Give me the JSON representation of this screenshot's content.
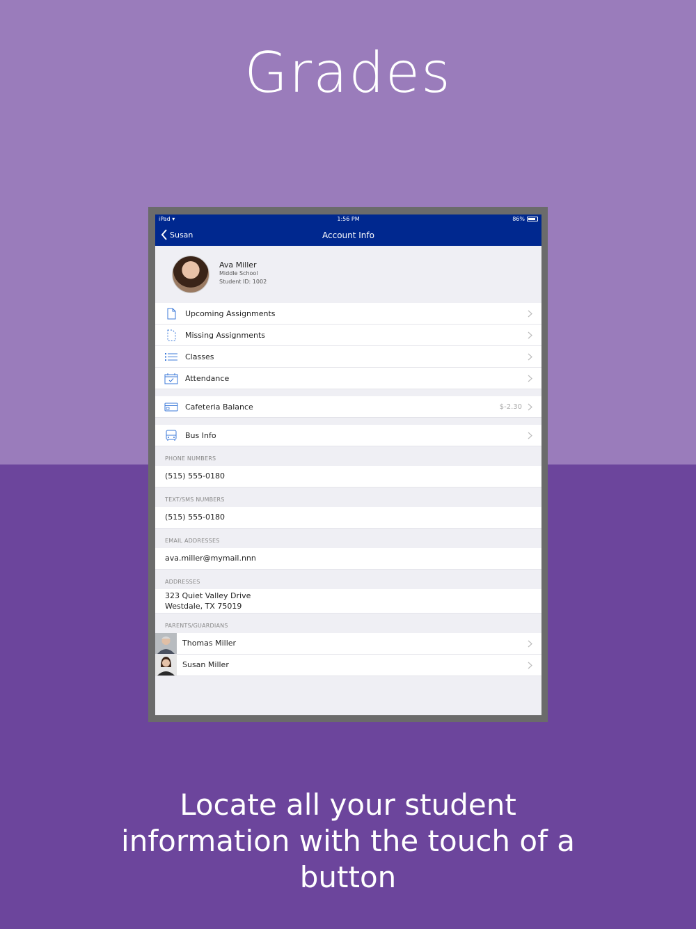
{
  "headline": "Grades",
  "tagline": "Locate all your student information with the touch of a button",
  "status_bar": {
    "device": "iPad",
    "time": "1:56 PM",
    "battery": "86%",
    "battery_level": 0.86
  },
  "nav": {
    "back_label": "Susan",
    "title": "Account Info"
  },
  "student": {
    "name": "Ava Miller",
    "school": "Middle School",
    "student_id": "Student ID: 1002"
  },
  "menu": [
    {
      "label": "Upcoming Assignments",
      "icon": "document-icon"
    },
    {
      "label": "Missing Assignments",
      "icon": "dashed-document-icon"
    },
    {
      "label": "Classes",
      "icon": "list-icon"
    },
    {
      "label": "Attendance",
      "icon": "calendar-check-icon"
    }
  ],
  "cafeteria": {
    "label": "Cafeteria Balance",
    "value": "$-2.30",
    "icon": "card-icon"
  },
  "bus": {
    "label": "Bus Info",
    "icon": "bus-icon"
  },
  "sections": {
    "phone_header": "PHONE NUMBERS",
    "phone": "(515) 555-0180",
    "sms_header": "TEXT/SMS NUMBERS",
    "sms": "(515) 555-0180",
    "email_header": "EMAIL ADDRESSES",
    "email": "ava.miller@mymail.nnn",
    "address_header": "ADDRESSES",
    "address_line1": "323 Quiet Valley Drive",
    "address_line2": "Westdale, TX 75019",
    "guardians_header": "PARENTS/GUARDIANS"
  },
  "guardians": [
    {
      "name": "Thomas Miller"
    },
    {
      "name": "Susan Miller"
    }
  ],
  "colors": {
    "bg_top": "#9a7cbb",
    "bg_bottom": "#6c459c",
    "nav_blue": "#00288f",
    "icon_blue": "#3b78d8"
  }
}
